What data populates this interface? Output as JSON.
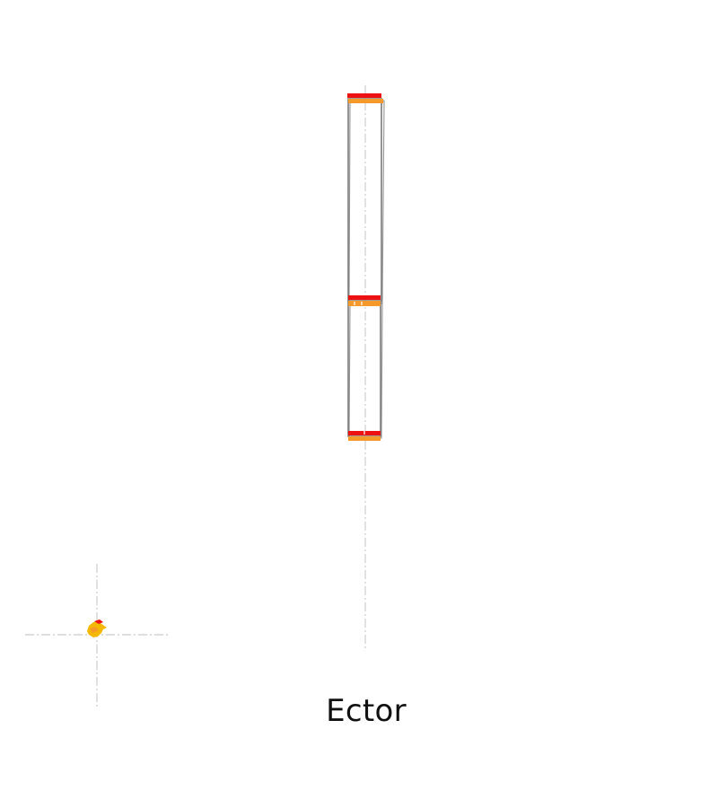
{
  "title": "Ector",
  "colors": {
    "background": "#ffffff",
    "outline": "#7a7a7a",
    "guide": "#d4d4d4",
    "accent_red": "#ee1111",
    "accent_orange": "#f59a2a",
    "marker_yellow": "#f5b800"
  },
  "icons": {
    "origin_marker": "origin-crosshair-icon"
  }
}
